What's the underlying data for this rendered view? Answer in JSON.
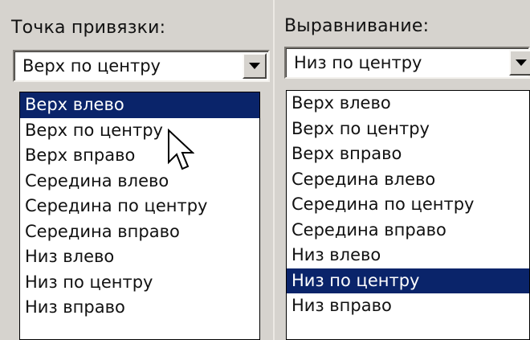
{
  "left_panel": {
    "label": "Точка привязки:",
    "selected_value": "Верх по центру",
    "highlighted_index": 0,
    "options": [
      "Верх влево",
      "Верх по центру",
      "Верх вправо",
      "Середина влево",
      "Середина по центру",
      "Середина вправо",
      "Низ влево",
      "Низ по центру",
      "Низ вправо"
    ]
  },
  "right_panel": {
    "label": "Выравнивание:",
    "selected_value": "Низ по центру",
    "highlighted_index": 7,
    "options": [
      "Верх влево",
      "Верх по центру",
      "Верх вправо",
      "Середина влево",
      "Середина по центру",
      "Середина вправо",
      "Низ влево",
      "Низ по центру",
      "Низ вправо"
    ]
  },
  "colors": {
    "highlight": "#0a246a",
    "panel_bg": "#d6d3ce"
  },
  "icons": {
    "dropdown": "chevron-down-icon",
    "pointer": "mouse-pointer-icon"
  }
}
